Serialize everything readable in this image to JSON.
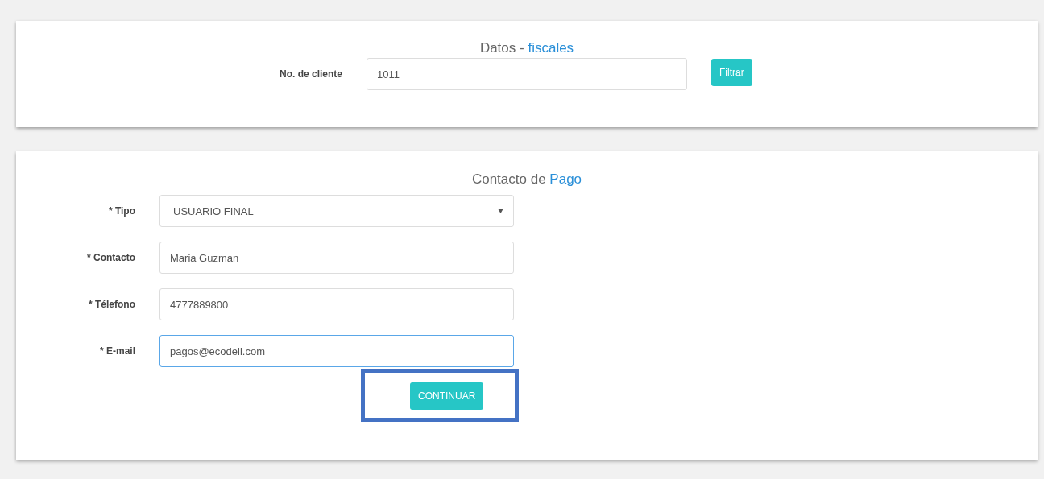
{
  "fiscal": {
    "title": "Datos - ",
    "title_accent": "fiscales",
    "client_label": "No. de cliente",
    "client_value": "1011",
    "filter_button": "Filtrar"
  },
  "payment": {
    "title": "Contacto de ",
    "title_accent": "Pago",
    "fields": [
      {
        "kind": "select",
        "label": "* Tipo",
        "value": "USUARIO FINAL",
        "focused": false
      },
      {
        "kind": "text",
        "label": "* Contacto",
        "value": "Maria Guzman",
        "focused": false
      },
      {
        "kind": "text",
        "label": "* Télefono",
        "value": "4777889800",
        "focused": false
      },
      {
        "kind": "text",
        "label": "* E-mail",
        "value": "pagos@ecodeli.com",
        "focused": true
      }
    ],
    "continue_button": "CONTINUAR",
    "continue_highlighted": true
  }
}
